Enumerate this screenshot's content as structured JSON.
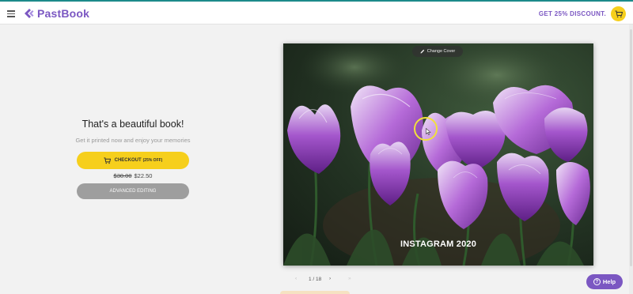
{
  "header": {
    "brand": "PastBook",
    "discount_text": "GET 25% DISCOUNT.",
    "brand_color": "#7b57c2",
    "accent_color": "#f6cf1c"
  },
  "main": {
    "title": "That's a beautiful book!",
    "subtitle": "Get it printed now and enjoy your memories",
    "checkout_label": "CHECKOUT",
    "checkout_discount": "(25% OFF)",
    "price_old": "$30.00",
    "price_new": "$22.50",
    "advanced_label": "ADVANCED EDITING"
  },
  "cover": {
    "change_cover_label": "Change Cover",
    "title_text": "INSTAGRAM 2020"
  },
  "pager": {
    "prev": "‹",
    "current": "1 / 18",
    "next": "›",
    "last": "»"
  },
  "help": {
    "label": "Help",
    "icon": "?"
  }
}
